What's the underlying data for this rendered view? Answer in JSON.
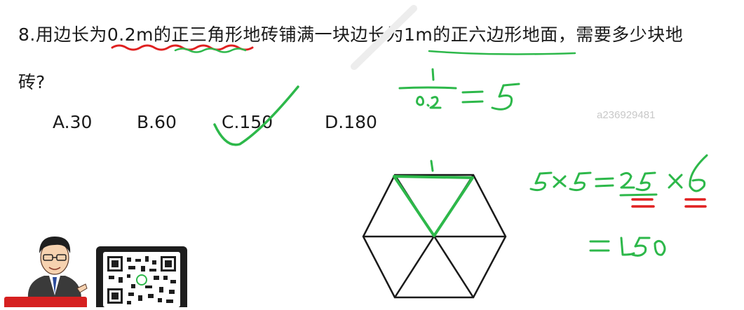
{
  "question": {
    "line1": "8.用边长为0.2m的正三角形地砖铺满一块边长为1m的正六边形地面，需要多少块地",
    "line2": "砖?"
  },
  "options": [
    {
      "label": "A.30"
    },
    {
      "label": "B.60"
    },
    {
      "label": "C.150"
    },
    {
      "label": "D.180"
    }
  ],
  "watermark": "a236929481",
  "colors": {
    "text": "#1a1a1a",
    "handwriting_green": "#2db84a",
    "handwriting_red": "#e02020",
    "watermark": "#c8c8c8"
  }
}
